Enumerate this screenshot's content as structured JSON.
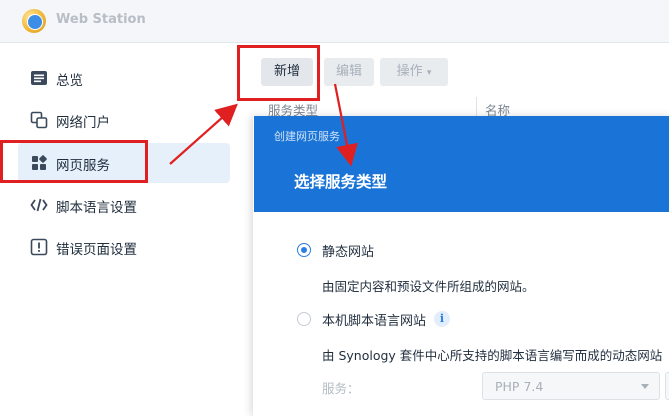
{
  "window": {
    "title": "Web Station",
    "icon": "web-station-icon"
  },
  "sidebar": {
    "items": [
      {
        "label": "总览",
        "icon": "overview-icon"
      },
      {
        "label": "网络门户",
        "icon": "web-portal-icon"
      },
      {
        "label": "网页服务",
        "icon": "web-service-icon",
        "active": true
      },
      {
        "label": "脚本语言设置",
        "icon": "code-icon"
      },
      {
        "label": "错误页面设置",
        "icon": "error-page-icon"
      }
    ]
  },
  "toolbar": {
    "add_label": "新增",
    "edit_label": "编辑",
    "ops_label": "操作"
  },
  "table": {
    "columns": [
      "服务类型",
      "名称"
    ]
  },
  "dialog": {
    "subtitle": "创建网页服务",
    "title": "选择服务类型",
    "options": [
      {
        "label": "静态网站",
        "description": "由固定内容和预设文件所组成的网站。",
        "checked": true
      },
      {
        "label": "本机脚本语言网站",
        "description": "由 Synology 套件中心所支持的脚本语言编写而成的动态网站",
        "checked": false
      }
    ],
    "service_label": "服务：",
    "service_value": "PHP 7.4"
  },
  "colors": {
    "accent": "#1a73d6",
    "highlight": "#e02020",
    "active_bg": "#e6f0fb"
  }
}
